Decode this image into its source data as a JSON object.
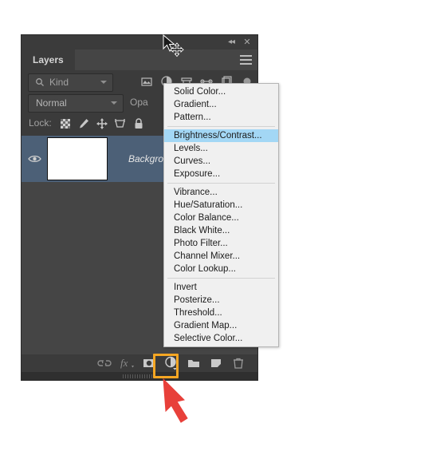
{
  "panel": {
    "tab_label": "Layers",
    "collapse_label": "◂◂",
    "close_label": "✕",
    "filter": {
      "kind_label": "Kind",
      "icons": [
        {
          "name": "filter-pixel-icon"
        },
        {
          "name": "filter-adjustment-icon"
        },
        {
          "name": "filter-type-icon"
        },
        {
          "name": "filter-shape-icon"
        },
        {
          "name": "filter-smart-object-icon"
        },
        {
          "name": "filter-toggle-icon"
        }
      ]
    },
    "blend": {
      "mode_label": "Normal",
      "opacity_label": "Opa"
    },
    "lock": {
      "label": "Lock:",
      "icons": [
        {
          "name": "lock-transparent-pixels-icon"
        },
        {
          "name": "lock-image-pixels-icon"
        },
        {
          "name": "lock-position-icon"
        },
        {
          "name": "lock-artboard-nesting-icon"
        },
        {
          "name": "lock-all-icon"
        }
      ]
    },
    "layers": [
      {
        "name": "Background",
        "visible": true,
        "selected": true,
        "italic": true
      }
    ],
    "bottom_icons": [
      {
        "name": "link-layers-icon",
        "label": "⚭"
      },
      {
        "name": "layer-style-fx-icon",
        "label": "fx"
      },
      {
        "name": "add-layer-mask-icon",
        "label": "mask"
      },
      {
        "name": "new-adjustment-layer-icon",
        "label": "adjustment"
      },
      {
        "name": "new-group-icon",
        "label": "folder"
      },
      {
        "name": "new-layer-icon",
        "label": "new-layer"
      },
      {
        "name": "delete-layer-icon",
        "label": "trash"
      }
    ]
  },
  "adjustment_menu": {
    "groups": [
      {
        "items": [
          {
            "label": "Solid Color...",
            "selected": false
          },
          {
            "label": "Gradient...",
            "selected": false
          },
          {
            "label": "Pattern...",
            "selected": false
          }
        ]
      },
      {
        "items": [
          {
            "label": "Brightness/Contrast...",
            "selected": true
          },
          {
            "label": "Levels...",
            "selected": false
          },
          {
            "label": "Curves...",
            "selected": false
          },
          {
            "label": "Exposure...",
            "selected": false
          }
        ]
      },
      {
        "items": [
          {
            "label": "Vibrance...",
            "selected": false
          },
          {
            "label": "Hue/Saturation...",
            "selected": false
          },
          {
            "label": "Color Balance...",
            "selected": false
          },
          {
            "label": "Black  White...",
            "selected": false
          },
          {
            "label": "Photo Filter...",
            "selected": false
          },
          {
            "label": "Channel Mixer...",
            "selected": false
          },
          {
            "label": "Color Lookup...",
            "selected": false
          }
        ]
      },
      {
        "items": [
          {
            "label": "Invert",
            "selected": false
          },
          {
            "label": "Posterize...",
            "selected": false
          },
          {
            "label": "Threshold...",
            "selected": false
          },
          {
            "label": "Gradient Map...",
            "selected": false
          },
          {
            "label": "Selective Color...",
            "selected": false
          }
        ]
      }
    ]
  },
  "annotations": {
    "highlight_color": "#f5a623",
    "arrow_color": "#e8403a",
    "highlight_target": "new-adjustment-layer-icon"
  },
  "colors": {
    "panel_bg": "#3b3b3b",
    "list_bg": "#454545",
    "selected_layer": "#4c6077",
    "menu_bg": "#f0f0f0",
    "menu_highlight": "#a3d7f5",
    "text": "#d5d5d5"
  }
}
